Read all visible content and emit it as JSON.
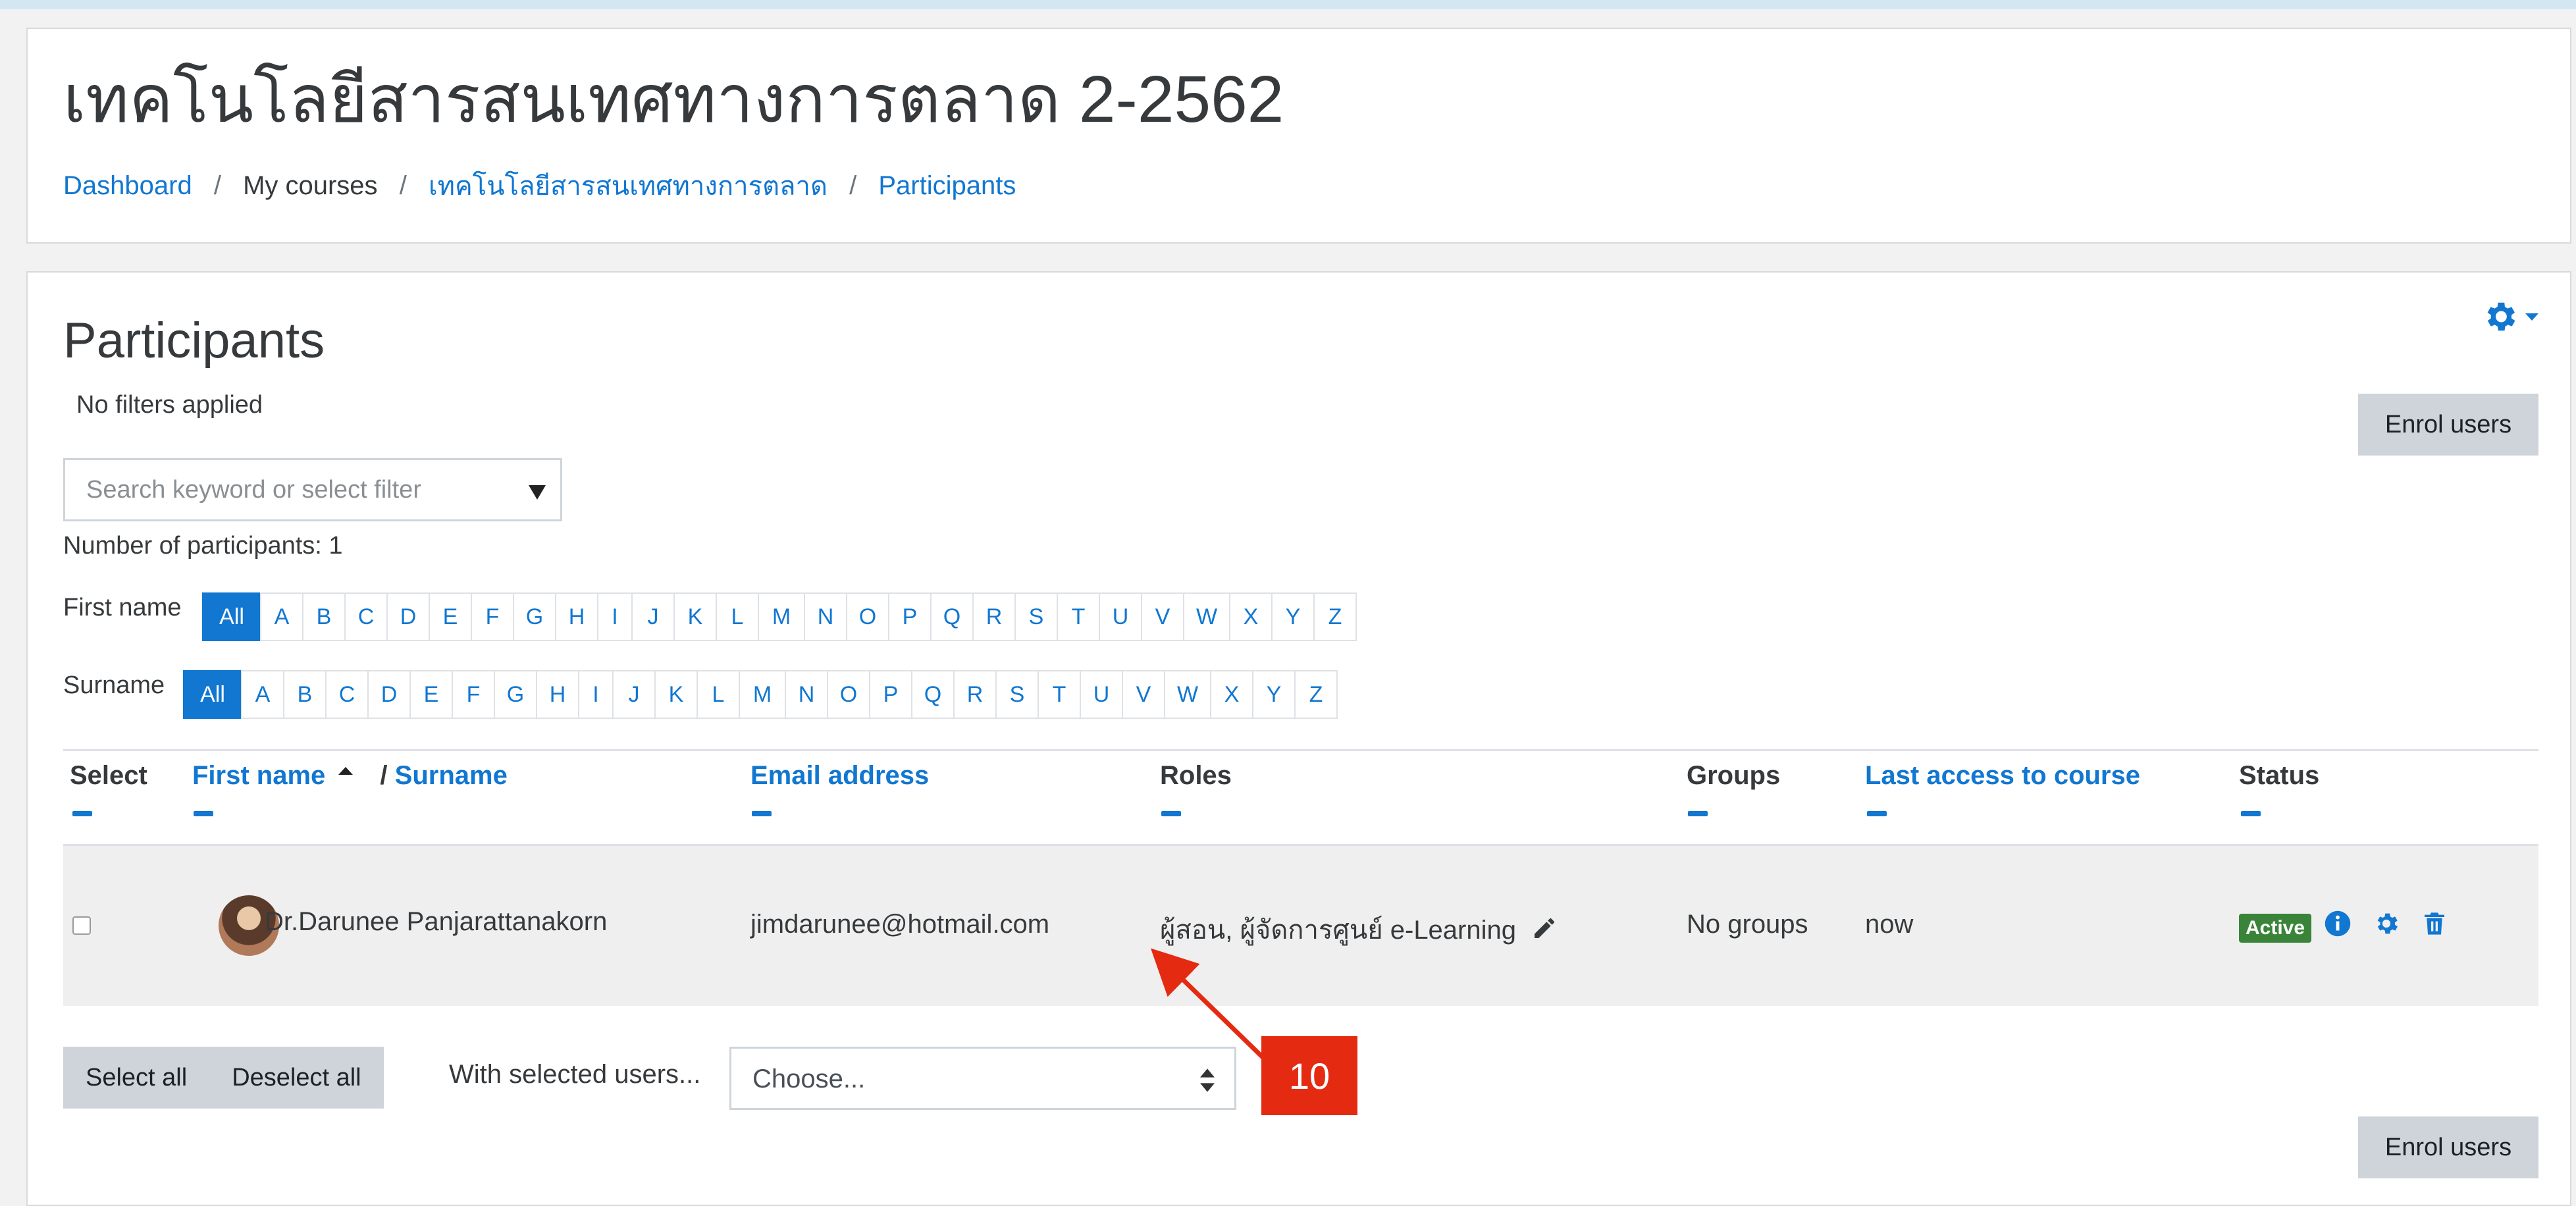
{
  "header": {
    "course_title": "เทคโนโลยีสารสนเทศทางการตลาด 2-2562",
    "breadcrumb": [
      "Dashboard",
      "My courses",
      "เทคโนโลยีสารสนเทศทางการตลาด",
      "Participants"
    ],
    "breadcrumb_separator": "/"
  },
  "participants": {
    "title": "Participants",
    "no_filters": "No filters applied",
    "search_placeholder": "Search keyword or select filter",
    "count_text": "Number of participants: 1",
    "enrol_button": "Enrol users"
  },
  "first_name_filter": {
    "label": "First name",
    "letters": [
      "All",
      "A",
      "B",
      "C",
      "D",
      "E",
      "F",
      "G",
      "H",
      "I",
      "J",
      "K",
      "L",
      "M",
      "N",
      "O",
      "P",
      "Q",
      "R",
      "S",
      "T",
      "U",
      "V",
      "W",
      "X",
      "Y",
      "Z"
    ],
    "selected": "All"
  },
  "surname_filter": {
    "label": "Surname",
    "letters": [
      "All",
      "A",
      "B",
      "C",
      "D",
      "E",
      "F",
      "G",
      "H",
      "I",
      "J",
      "K",
      "L",
      "M",
      "N",
      "O",
      "P",
      "Q",
      "R",
      "S",
      "T",
      "U",
      "V",
      "W",
      "X",
      "Y",
      "Z"
    ],
    "selected": "All"
  },
  "table": {
    "headers": {
      "select": "Select",
      "first_name": "First name",
      "name_separator": "/",
      "surname": "Surname",
      "email": "Email address",
      "roles": "Roles",
      "groups": "Groups",
      "last_access": "Last access to course",
      "status": "Status"
    },
    "rows": [
      {
        "name": "Dr.Darunee Panjarattanakorn",
        "email": "jimdarunee@hotmail.com",
        "roles": "ผู้สอน, ผู้จัดการศูนย์ e-Learning",
        "groups": "No groups",
        "last_access": "now",
        "status": "Active"
      }
    ]
  },
  "bulk_actions": {
    "select_all": "Select all",
    "deselect_all": "Deselect all",
    "with_selected_label": "With selected users...",
    "choose_value": "Choose..."
  },
  "annotation": {
    "number": "10"
  },
  "colors": {
    "link": "#1177d1",
    "active_badge": "#398439",
    "annotation": "#e52a12",
    "button_gray": "#ced4da"
  },
  "icons": [
    "gear-icon",
    "pencil-icon",
    "info-icon",
    "cog-icon",
    "trash-icon",
    "sort-ascending-icon",
    "select-arrows-icon"
  ]
}
